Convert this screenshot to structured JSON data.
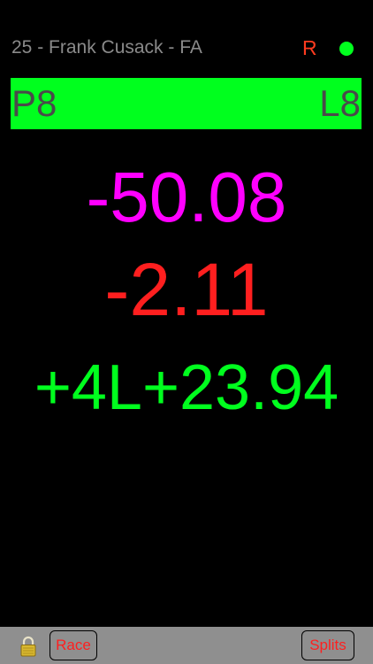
{
  "header": {
    "driver_label": "25 - Frank Cusack - FA",
    "r_indicator": "R",
    "status_dot_color": "#00ff1e"
  },
  "position_bar": {
    "left": "P8",
    "right": "L8",
    "background_color": "#00ff1e"
  },
  "readouts": {
    "value1": "-50.08",
    "value1_color": "#ff00ff",
    "value2": "-2.11",
    "value2_color": "#ff1f1f",
    "value3": "+4L+23.94",
    "value3_color": "#00ff1e"
  },
  "toolbar": {
    "lock_icon": "lock-icon",
    "race_label": "Race",
    "splits_label": "Splits"
  }
}
